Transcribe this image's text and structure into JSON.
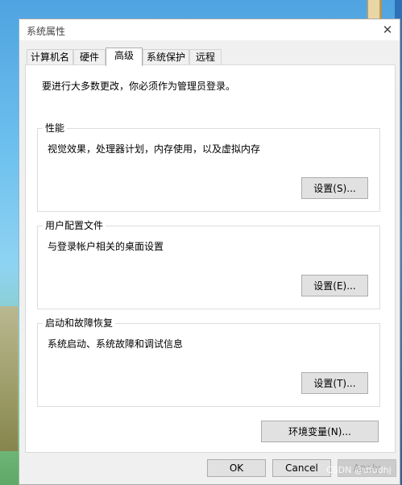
{
  "window": {
    "title": "系统属性",
    "close_glyph": "✕"
  },
  "tabs": [
    {
      "label": "计算机名",
      "active": false
    },
    {
      "label": "硬件",
      "active": false
    },
    {
      "label": "高级",
      "active": true
    },
    {
      "label": "系统保护",
      "active": false
    },
    {
      "label": "远程",
      "active": false
    }
  ],
  "advanced": {
    "admin_note": "要进行大多数更改，你必须作为管理员登录。",
    "performance": {
      "title": "性能",
      "description": "视觉效果，处理器计划，内存使用，以及虚拟内存",
      "button": "设置(S)..."
    },
    "user_profiles": {
      "title": "用户配置文件",
      "description": "与登录帐户相关的桌面设置",
      "button": "设置(E)..."
    },
    "startup_recovery": {
      "title": "启动和故障恢复",
      "description": "系统启动、系统故障和调试信息",
      "button": "设置(T)..."
    },
    "env_button": "环境变量(N)..."
  },
  "footer": {
    "ok": "OK",
    "cancel": "Cancel",
    "apply": "Apply"
  },
  "watermark": "CSDN @dfudhj"
}
